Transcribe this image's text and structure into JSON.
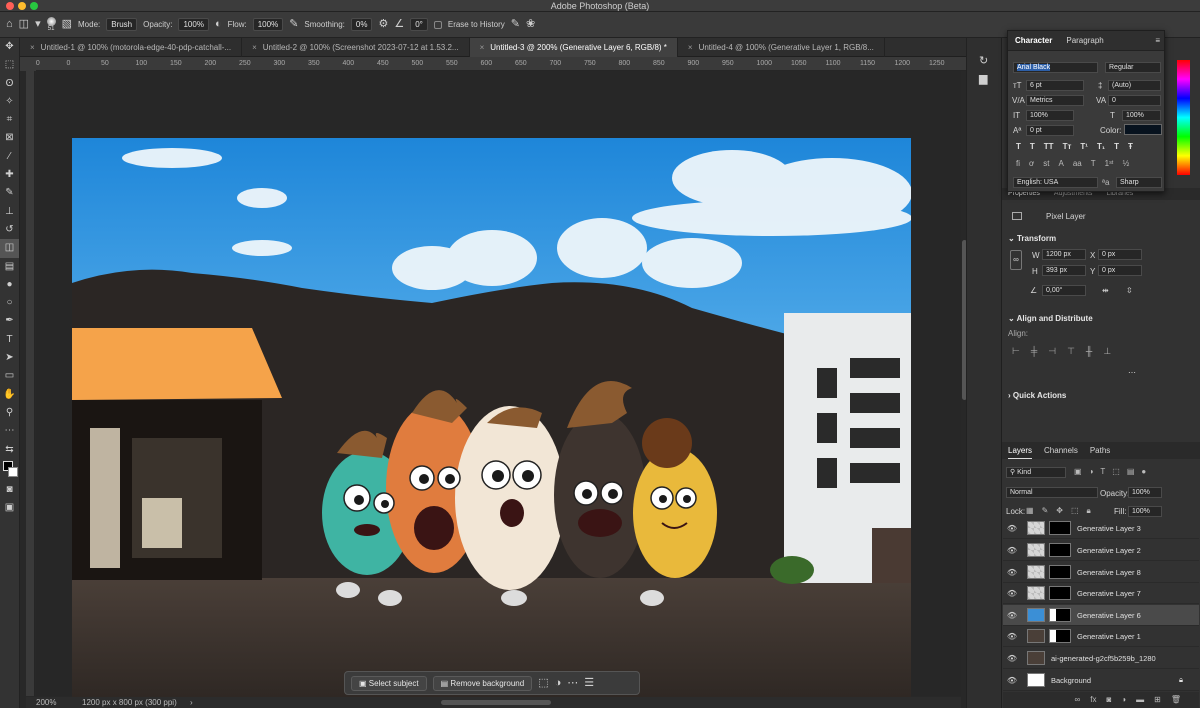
{
  "app": {
    "title": "Adobe Photoshop (Beta)"
  },
  "options": {
    "brush_size": "51",
    "mode_label": "Mode:",
    "mode_value": "Brush",
    "opacity_label": "Opacity:",
    "opacity_value": "100%",
    "flow_label": "Flow:",
    "flow_value": "100%",
    "smoothing_label": "Smoothing:",
    "smoothing_value": "0%",
    "angle_value": "0°",
    "erase_history_label": "Erase to History"
  },
  "tabs": [
    {
      "label": "Untitled-1 @ 100% (motorola-edge-40-pdp-catchall-..."
    },
    {
      "label": "Untitled-2 @ 100% (Screenshot 2023-07-12 at 1.53.2..."
    },
    {
      "label": "Untitled-3 @ 200% (Generative Layer 6, RGB/8) *"
    },
    {
      "label": "Untitled-4 @ 100% (Generative Layer 1, RGB/8..."
    }
  ],
  "ruler_ticks": [
    "50",
    "0",
    "50",
    "100",
    "150",
    "200",
    "250",
    "300",
    "350",
    "400",
    "450",
    "500",
    "550",
    "600",
    "650",
    "700",
    "750",
    "800",
    "850",
    "900",
    "950",
    "1000",
    "1050",
    "1100",
    "1150",
    "1200",
    "1250"
  ],
  "status": {
    "zoom": "200%",
    "doc_info": "1200 px x 800 px (300 ppi)"
  },
  "contextual": {
    "select_subject": "Select subject",
    "remove_background": "Remove background"
  },
  "character": {
    "tabs": [
      "Character",
      "Paragraph"
    ],
    "font_family": "Arial Black",
    "font_style": "Regular",
    "font_size": "6 pt",
    "leading": "(Auto)",
    "kerning": "Metrics",
    "tracking": "0",
    "vertical_scale": "100%",
    "horizontal_scale": "100%",
    "baseline": "0 pt",
    "color_label": "Color:",
    "language": "English: USA",
    "antialias": "Sharp"
  },
  "properties": {
    "tabs": [
      "Properties",
      "Adjustments",
      "Libraries"
    ],
    "kind": "Pixel Layer",
    "transform_label": "Transform",
    "w_label": "W",
    "w_value": "1200 px",
    "h_label": "H",
    "h_value": "393 px",
    "x_label": "X",
    "x_value": "0 px",
    "y_label": "Y",
    "y_value": "0 px",
    "angle": "0,00°",
    "align_label": "Align and Distribute",
    "align_sub": "Align:",
    "quick_actions": "Quick Actions"
  },
  "layers_panel": {
    "tabs": [
      "Layers",
      "Channels",
      "Paths"
    ],
    "kind_filter": "Kind",
    "blend_mode": "Normal",
    "opacity_label": "Opacity:",
    "opacity_value": "100%",
    "lock_label": "Lock:",
    "fill_label": "Fill:",
    "fill_value": "100%",
    "layers": [
      {
        "name": "Generative Layer 3"
      },
      {
        "name": "Generative Layer 2"
      },
      {
        "name": "Generative Layer 8"
      },
      {
        "name": "Generative Layer 7"
      },
      {
        "name": "Generative Layer 6"
      },
      {
        "name": "Generative Layer 1"
      },
      {
        "name": "ai-generated-g2cf5b259b_1280"
      },
      {
        "name": "Background"
      }
    ]
  },
  "colors": {
    "accent": "#2d7cf6",
    "panel": "#323232"
  }
}
